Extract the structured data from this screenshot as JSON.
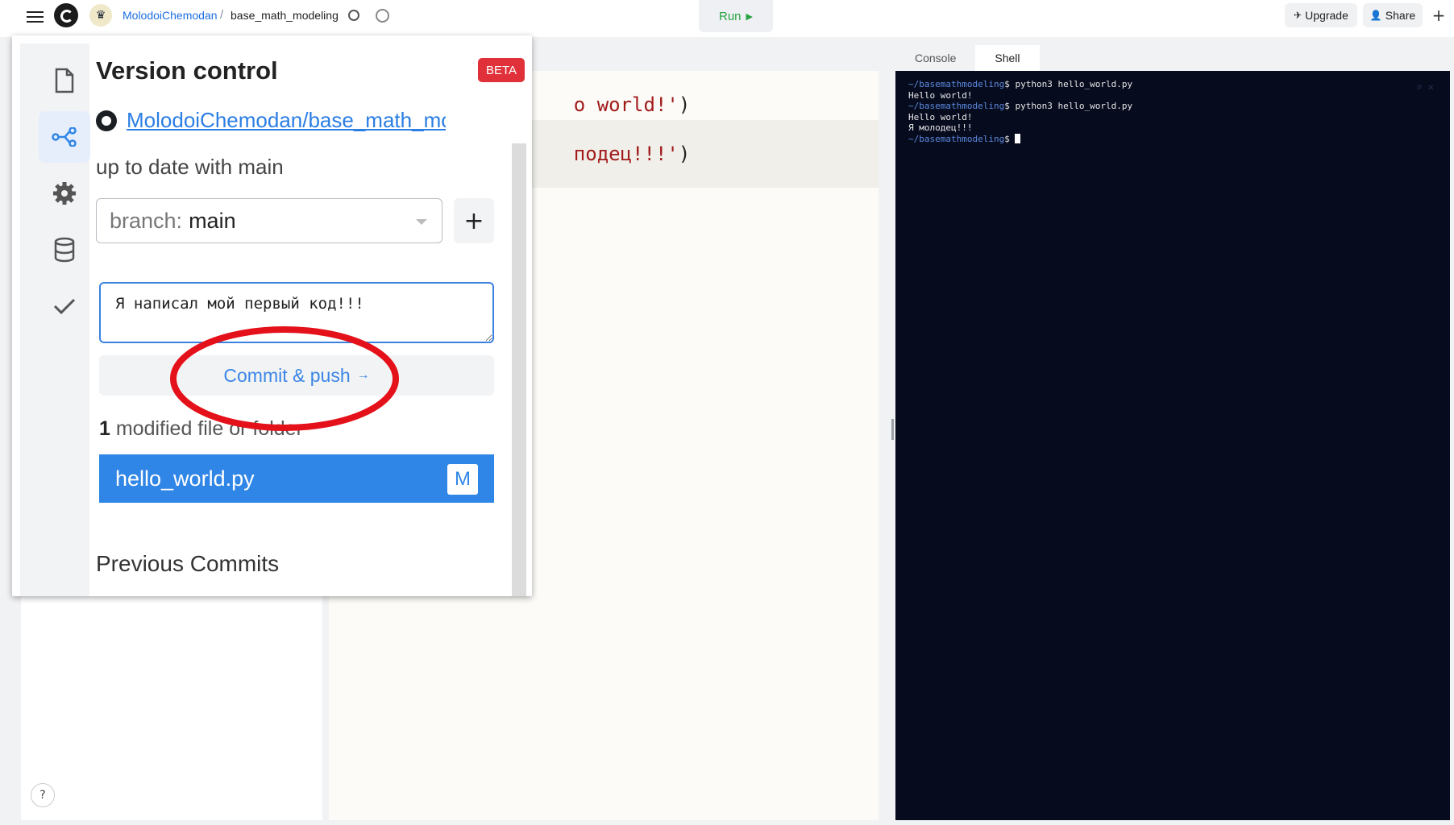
{
  "topbar": {
    "owner": "MolodoiChemodan",
    "separator": "/",
    "repl_name": "base_math_modeling",
    "run_label": "Run",
    "run_icon": "▶",
    "upgrade_label": "Upgrade",
    "share_label": "Share",
    "plus_label": "+"
  },
  "editor": {
    "lines": [
      {
        "text": "o world!'",
        "paren": ")"
      },
      {
        "text": "подец!!!'",
        "paren": ")"
      }
    ]
  },
  "right_panel": {
    "tabs": [
      {
        "label": "Console",
        "active": false
      },
      {
        "label": "Shell",
        "active": true
      }
    ],
    "terminal": {
      "prompt": "~/basemathmodeling",
      "lines": [
        {
          "prompt": "~/basemathmodeling",
          "text": "$ python3 hello_world.py"
        },
        {
          "prompt": "",
          "text": "Hello world!"
        },
        {
          "prompt": "~/basemathmodeling",
          "text": "$ python3 hello_world.py"
        },
        {
          "prompt": "",
          "text": "Hello world!"
        },
        {
          "prompt": "",
          "text": "Я молодец!!!"
        },
        {
          "prompt": "~/basemathmodeling",
          "text": "$ "
        }
      ],
      "tools": "⌕ ✕"
    }
  },
  "version_control": {
    "title": "Version control",
    "badge": "BETA",
    "repo_link": "MolodoiChemodan/base_math_modeling",
    "status": "up to date with main",
    "branch_label": "branch:",
    "branch_value": "main",
    "branch_add": "+",
    "commit_message": "Я написал мой первый код!!!",
    "commit_button": "Commit & push",
    "commit_arrow": "→",
    "modified_count": "1",
    "modified_label": "modified file or folder",
    "files": [
      {
        "name": "hello_world.py",
        "status": "M"
      }
    ],
    "previous_commits": "Previous Commits"
  },
  "help_label": "?",
  "colors": {
    "accent": "#2f86e6",
    "beta": "#e0313a",
    "run": "#27a343",
    "terminal_bg": "#070b1e",
    "annotation": "#e4111a"
  }
}
